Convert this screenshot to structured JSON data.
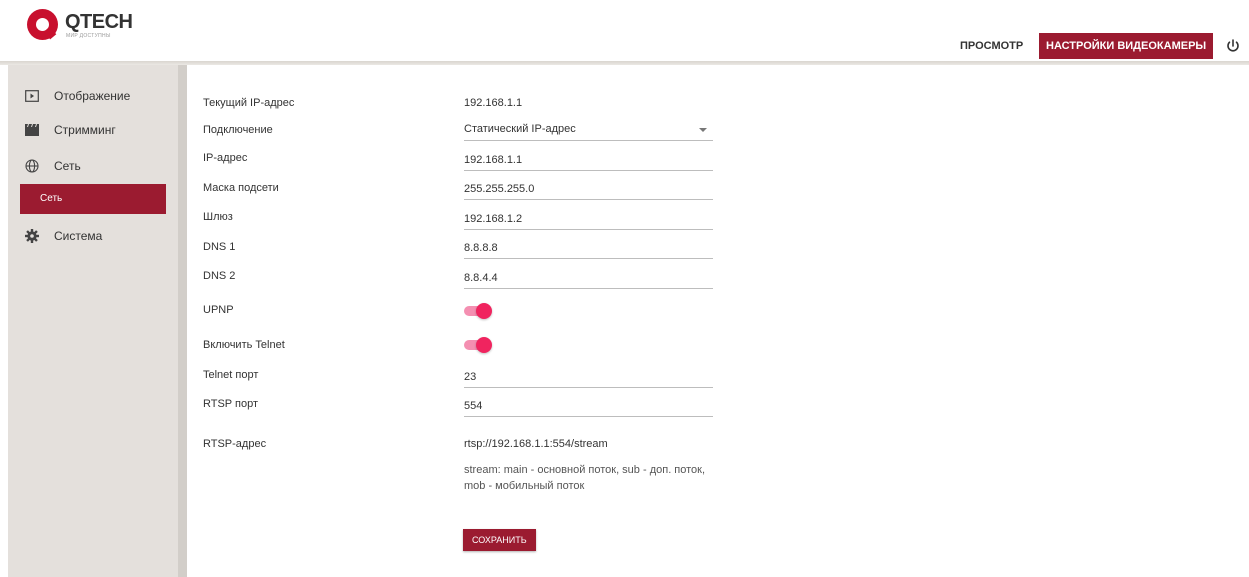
{
  "brand": {
    "name": "QTECH",
    "tagline": "МИР ДОСТУПНЫ"
  },
  "topnav": {
    "view_label": "ПРОСМОТР",
    "settings_label": "НАСТРОЙКИ ВИДЕОКАМЕРЫ",
    "power_icon": "power-icon"
  },
  "colors": {
    "accent": "#9b1b30",
    "toggle_on": "#f0245f",
    "sidebar_bg": "#e4e0dc"
  },
  "sidebar": {
    "items": [
      {
        "label": "Отображение",
        "icon": "display-icon"
      },
      {
        "label": "Стримминг",
        "icon": "film-icon"
      },
      {
        "label": "Сеть",
        "icon": "globe-icon"
      },
      {
        "label": "Система",
        "icon": "gear-icon"
      }
    ],
    "active_sub": "Сеть"
  },
  "form": {
    "current_ip": {
      "label": "Текущий IP-адрес",
      "value": "192.168.1.1"
    },
    "connection": {
      "label": "Подключение",
      "value": "Статический IP-адрес"
    },
    "ip": {
      "label": "IP-адрес",
      "value": "192.168.1.1"
    },
    "mask": {
      "label": "Маска подсети",
      "value": "255.255.255.0"
    },
    "gateway": {
      "label": "Шлюз",
      "value": "192.168.1.2"
    },
    "dns1": {
      "label": "DNS 1",
      "value": "8.8.8.8"
    },
    "dns2": {
      "label": "DNS 2",
      "value": "8.8.4.4"
    },
    "upnp": {
      "label": "UPNP",
      "enabled": true
    },
    "telnet": {
      "label": "Включить Telnet",
      "enabled": true
    },
    "telnet_port": {
      "label": "Telnet порт",
      "value": "23"
    },
    "rtsp_port": {
      "label": "RTSP порт",
      "value": "554"
    },
    "rtsp_addr": {
      "label": "RTSP-адрес",
      "value": "rtsp://192.168.1.1:554/stream"
    },
    "note": "stream: main - основной поток, sub - доп. поток, mob - мобильный поток",
    "save_label": "СОХРАНИТЬ"
  }
}
